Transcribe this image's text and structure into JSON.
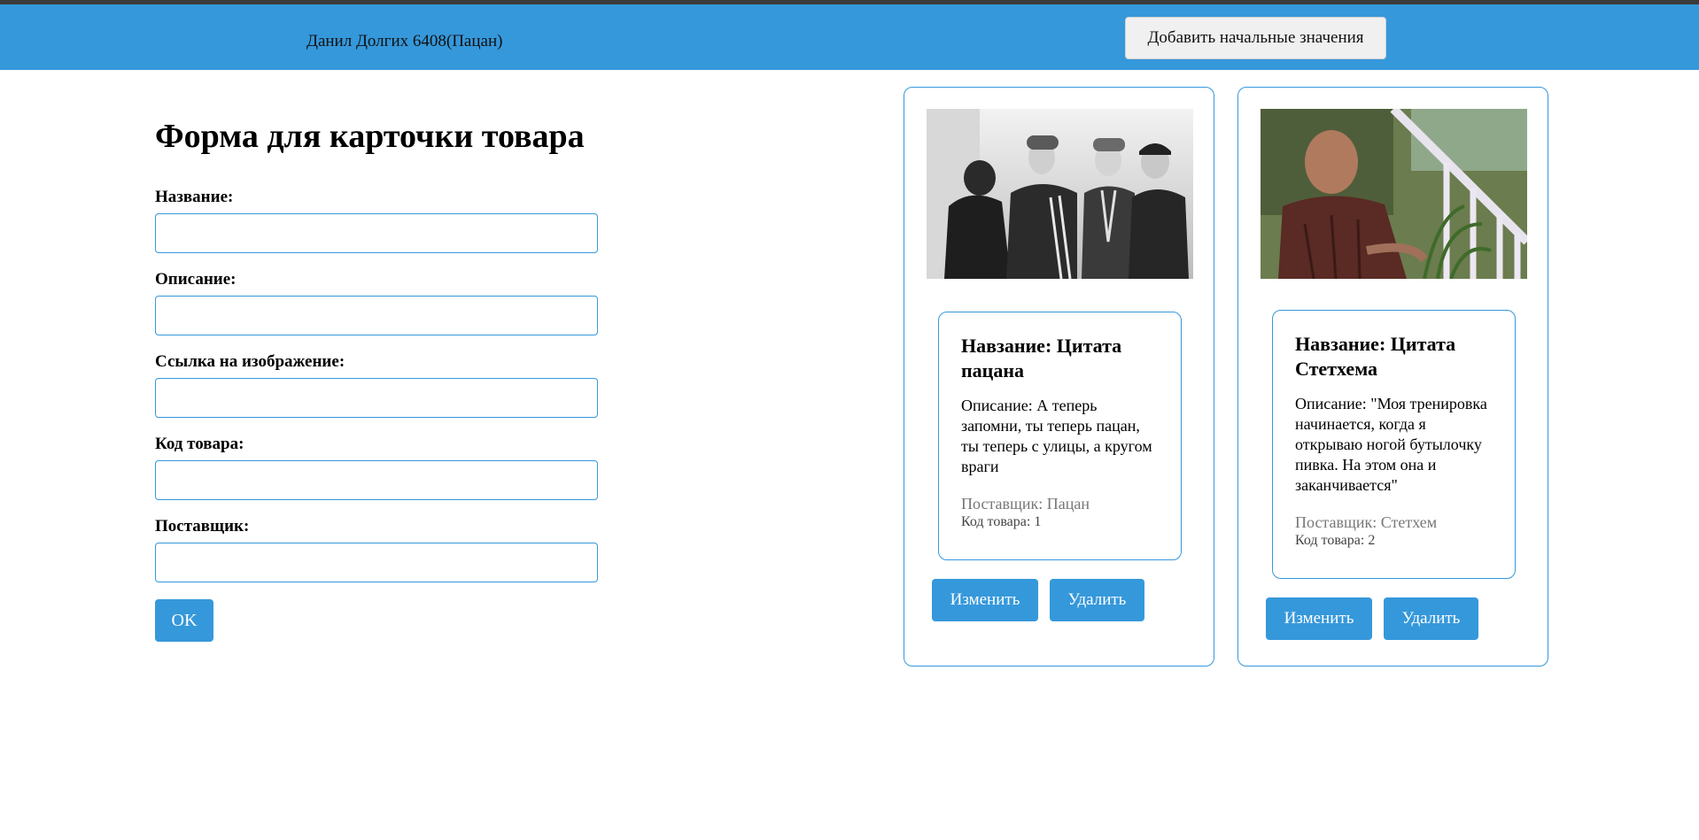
{
  "header": {
    "user_label": "Данил Долгих 6408(Пацан)",
    "add_initial_button": "Добавить начальные значения"
  },
  "form": {
    "title": "Форма для карточки товара",
    "fields": [
      {
        "label": "Название:",
        "value": "",
        "placeholder": ""
      },
      {
        "label": "Описание:",
        "value": "",
        "placeholder": ""
      },
      {
        "label": "Ссылка на изображение:",
        "value": "",
        "placeholder": ""
      },
      {
        "label": "Код товара:",
        "value": "",
        "placeholder": ""
      },
      {
        "label": "Поставщик:",
        "value": "",
        "placeholder": ""
      }
    ],
    "submit_label": "OK"
  },
  "cards": [
    {
      "title": "Навзание: Цитата пацана",
      "description": "Описание: А теперь запомни, ты теперь пацан, ты теперь с улицы, а кругом враги",
      "supplier": "Поставщик: Пацан",
      "code": "Код товара: 1",
      "edit_label": "Изменить",
      "delete_label": "Удалить",
      "image": "black-and-white-group-photo"
    },
    {
      "title": "Навзание: Цитата Стетхема",
      "description": "Описание: \"Моя тренировка начинается, когда я открываю ногой бутылочку пивка. На этом она и заканчивается\"",
      "supplier": "Поставщик: Стетхем",
      "code": "Код товара: 2",
      "edit_label": "Изменить",
      "delete_label": "Удалить",
      "image": "man-on-porch-photo"
    }
  ],
  "colors": {
    "accent": "#3598db",
    "header_strip": "#3b3b3b",
    "muted_text": "#777777"
  }
}
